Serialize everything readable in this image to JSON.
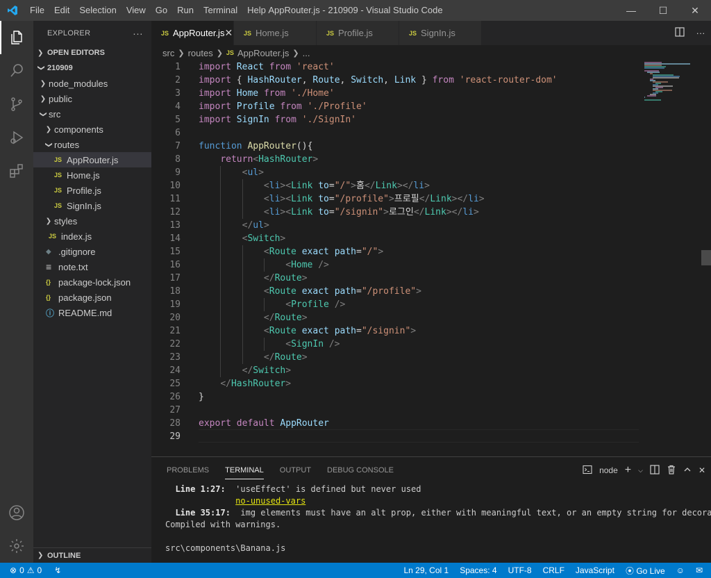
{
  "window": {
    "title": "AppRouter.js - 210909 - Visual Studio Code",
    "menu": [
      "File",
      "Edit",
      "Selection",
      "View",
      "Go",
      "Run",
      "Terminal",
      "Help"
    ]
  },
  "sidebar": {
    "header": "EXPLORER",
    "open_editors": "OPEN EDITORS",
    "project": "210909",
    "outline": "OUTLINE",
    "tree": [
      {
        "label": "node_modules",
        "type": "folder",
        "expanded": false,
        "depth": 1
      },
      {
        "label": "public",
        "type": "folder",
        "expanded": false,
        "depth": 1
      },
      {
        "label": "src",
        "type": "folder",
        "expanded": true,
        "depth": 1
      },
      {
        "label": "components",
        "type": "folder",
        "expanded": false,
        "depth": 2
      },
      {
        "label": "routes",
        "type": "folder",
        "expanded": true,
        "depth": 2
      },
      {
        "label": "AppRouter.js",
        "type": "js",
        "depth": 3,
        "selected": true
      },
      {
        "label": "Home.js",
        "type": "js",
        "depth": 3
      },
      {
        "label": "Profile.js",
        "type": "js",
        "depth": 3
      },
      {
        "label": "SignIn.js",
        "type": "js",
        "depth": 3
      },
      {
        "label": "styles",
        "type": "folder",
        "expanded": false,
        "depth": 2
      },
      {
        "label": "index.js",
        "type": "js",
        "depth": 2
      },
      {
        "label": ".gitignore",
        "type": "git",
        "depth": 1
      },
      {
        "label": "note.txt",
        "type": "txt",
        "depth": 1
      },
      {
        "label": "package-lock.json",
        "type": "json",
        "depth": 1
      },
      {
        "label": "package.json",
        "type": "json",
        "depth": 1
      },
      {
        "label": "README.md",
        "type": "info",
        "depth": 1
      }
    ]
  },
  "tabs": [
    {
      "label": "AppRouter.js",
      "active": true
    },
    {
      "label": "Home.js",
      "active": false
    },
    {
      "label": "Profile.js",
      "active": false
    },
    {
      "label": "SignIn.js",
      "active": false
    }
  ],
  "breadcrumb": [
    "src",
    "routes",
    "AppRouter.js",
    "..."
  ],
  "code_lines": [
    "import React from 'react'",
    "import { HashRouter, Route, Switch, Link } from 'react-router-dom'",
    "import Home from './Home'",
    "import Profile from './Profile'",
    "import SignIn from './SignIn'",
    "",
    "function AppRouter(){",
    "    return<HashRouter>",
    "        <ul>",
    "            <li><Link to=\"/\">홈</Link></li>",
    "            <li><Link to=\"/profile\">프로필</Link></li>",
    "            <li><Link to=\"/signin\">로그인</Link></li>",
    "        </ul>",
    "        <Switch>",
    "            <Route exact path=\"/\">",
    "                <Home />",
    "            </Route>",
    "            <Route exact path=\"/profile\">",
    "                <Profile />",
    "            </Route>",
    "            <Route exact path=\"/signin\">",
    "                <SignIn />",
    "            </Route>",
    "        </Switch>",
    "    </HashRouter>",
    "}",
    "",
    "export default AppRouter",
    ""
  ],
  "panel": {
    "tabs": [
      "PROBLEMS",
      "TERMINAL",
      "OUTPUT",
      "DEBUG CONSOLE"
    ],
    "active_tab": "TERMINAL",
    "terminal_selector": "node",
    "terminal_lines": [
      {
        "text": "  Line 1:27:  'useEffect' is defined but never used",
        "style": "warn1"
      },
      {
        "text": "              no-unused-vars",
        "style": "rule"
      },
      {
        "text": "  Line 35:17:  img elements must have an alt prop, either with meaningful text, or an empty string for decora",
        "style": "warn2"
      },
      {
        "text": "Compiled with warnings.",
        "style": "yellow"
      },
      {
        "text": "",
        "style": "plain"
      },
      {
        "text": "src\\components\\Banana.js",
        "style": "plain"
      }
    ]
  },
  "statusbar": {
    "errors": "0",
    "warnings": "0",
    "position": "Ln 29, Col 1",
    "spaces": "Spaces: 4",
    "encoding": "UTF-8",
    "eol": "CRLF",
    "language": "JavaScript",
    "golive": "Go Live"
  }
}
